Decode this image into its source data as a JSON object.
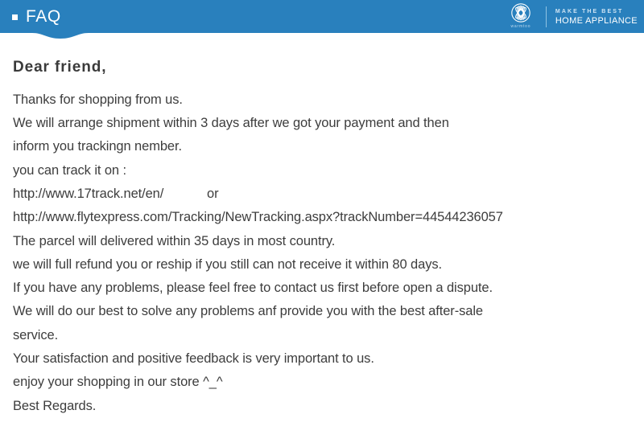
{
  "header": {
    "title": "FAQ",
    "bullet_icon": "square-bullet-icon",
    "background_color": "#2980bd",
    "brand": {
      "logo_icon": "warmtoo-circle-logo-icon",
      "wordmark": "warmtoo",
      "tagline_top": "MAKE THE BEST",
      "tagline_bottom": "HOME APPLIANCE"
    }
  },
  "content": {
    "greeting": "Dear friend,",
    "lines": [
      "Thanks for shopping from us.",
      "We will arrange shipment within 3 days after we got your payment and then",
      "inform you trackingn nember.",
      "you can track it on :",
      "http://www.17track.net/en/            or",
      "http://www.flytexpress.com/Tracking/NewTracking.aspx?trackNumber=44544236057",
      "The parcel will delivered within 35 days in most country.",
      "we will full refund you or reship if you still can not receive it within 80 days.",
      "If you have any problems, please feel free to contact us first before open a dispute.",
      "We will do our best to solve any problems anf provide you with the best after-sale",
      "service.",
      "Your satisfaction and positive feedback is very important to us.",
      "enjoy your shopping in our store ^_^",
      "Best Regards."
    ]
  }
}
